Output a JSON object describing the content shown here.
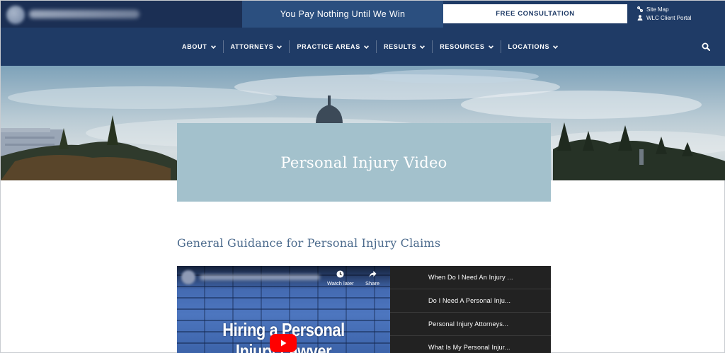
{
  "header": {
    "tagline": "You Pay Nothing Until We Win",
    "cta_label": "FREE CONSULTATION",
    "utility_links": [
      {
        "label": "Site Map",
        "icon": "sitemap-icon"
      },
      {
        "label": "WLC Client Portal",
        "icon": "user-icon"
      }
    ]
  },
  "nav": {
    "items": [
      {
        "label": "ABOUT"
      },
      {
        "label": "ATTORNEYS"
      },
      {
        "label": "PRACTICE AREAS"
      },
      {
        "label": "RESULTS"
      },
      {
        "label": "RESOURCES"
      },
      {
        "label": "LOCATIONS"
      }
    ],
    "search_icon": "search-icon"
  },
  "hero": {
    "title": "Personal Injury Video"
  },
  "section": {
    "heading": "General Guidance for Personal Injury Claims"
  },
  "video": {
    "watch_later_label": "Watch later",
    "share_label": "Share",
    "thumbnail_title_line1": "Hiring a Personal",
    "thumbnail_title_line2": "Injury Lawyer",
    "playlist": [
      "When Do I Need An Injury ...",
      "Do I Need A Personal Inju...",
      "Personal Injury Attorneys...",
      "What Is My Personal Injur..."
    ]
  },
  "colors": {
    "navy": "#1f3b66",
    "tagline_blue": "#2b4f7f",
    "title_box": "#a3c1cc",
    "heading_blue": "#4b6a8c",
    "youtube_red": "#ff0000"
  }
}
